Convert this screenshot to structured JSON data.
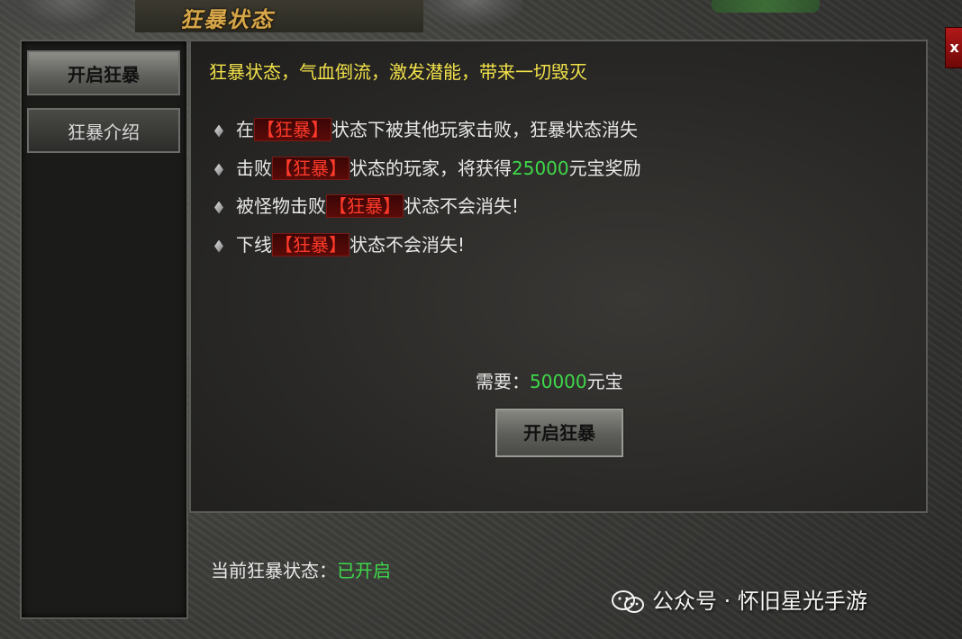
{
  "window": {
    "title": "狂暴状态",
    "close_label": "x"
  },
  "sidebar": {
    "items": [
      {
        "label": "开启狂暴",
        "active": true
      },
      {
        "label": "狂暴介绍",
        "active": false
      }
    ]
  },
  "main": {
    "headline": "狂暴状态，气血倒流，激发潜能，带来一切毁灭",
    "rules": [
      {
        "before": "在",
        "tag": "【狂暴】",
        "after": "状态下被其他玩家击败，狂暴状态消失"
      },
      {
        "before": "击败",
        "tag": "【狂暴】",
        "after": "状态的玩家，将获得",
        "highlight": "25000",
        "after2": "元宝奖励"
      },
      {
        "before": "被怪物击败",
        "tag": "【狂暴】",
        "after": "状态不会消失!"
      },
      {
        "before": "下线",
        "tag": "【狂暴】",
        "after": "状态不会消失!"
      }
    ],
    "cost_label": "需要：",
    "cost_value": "50000",
    "cost_unit": "元宝",
    "open_button": "开启狂暴"
  },
  "status": {
    "label": "当前狂暴状态：",
    "value": "已开启"
  },
  "watermark": {
    "text": "公众号 · 怀旧星光手游"
  },
  "colors": {
    "headline": "#f2e24a",
    "tag": "#ff3a2a",
    "highlight": "#3ed94a",
    "title": "#d6a64a"
  }
}
